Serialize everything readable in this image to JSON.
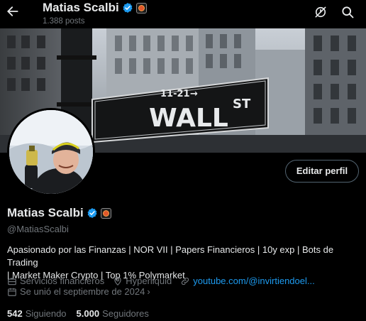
{
  "header": {
    "name": "Matias Scalbi",
    "posts": "1.388 posts"
  },
  "banner": {
    "sign_street_number": "11-21",
    "sign_text": "WALL",
    "sign_suffix": "ST"
  },
  "profile": {
    "name": "Matias Scalbi",
    "handle": "@MatiasScalbi",
    "edit_button": "Editar perfil",
    "bio_line1": "Apasionado por las Finanzas | NOR VII | Papers Financieros | 10y exp | Bots de Trading",
    "bio_line2": "| Market Maker Crypto | Top 1% Polymarket",
    "category": "Servicios financieros",
    "location": "Hyperliquid",
    "website": "youtube.com/@invirtiendoel...",
    "joined": "Se unió el septiembre de 2024",
    "following_count": "542",
    "following_label": "Siguiendo",
    "followers_count": "5.000",
    "followers_label": "Seguidores"
  },
  "colors": {
    "accent": "#1d9bf0",
    "secondary_text": "#71767b",
    "primary_text": "#e7e9ea",
    "background": "#000000"
  },
  "icons": [
    "back-arrow-icon",
    "verified-badge-icon",
    "org-badge-icon",
    "notifications-off-icon",
    "search-icon",
    "briefcase-icon",
    "location-pin-icon",
    "link-icon",
    "calendar-icon",
    "chevron-right-icon"
  ]
}
